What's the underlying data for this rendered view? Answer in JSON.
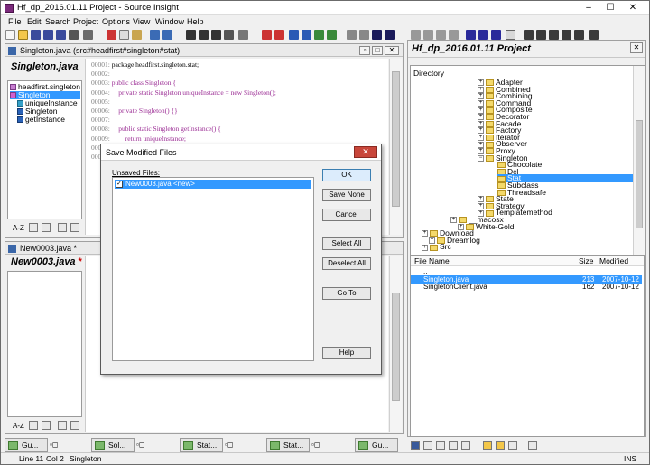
{
  "window": {
    "title": "Hf_dp_2016.01.11 Project - Source Insight",
    "min": "–",
    "max": "☐",
    "close": "✕"
  },
  "menu": [
    "File",
    "Edit",
    "Search",
    "Project",
    "Options",
    "View",
    "Window",
    "Help"
  ],
  "left_top_panel": {
    "window_title": "Singleton.java (src#headfirst#singleton#stat)",
    "symbol_heading": "Singleton.java",
    "symbols": [
      "headfirst.singleton",
      "Singleton",
      "uniqueInstance",
      "Singleton",
      "getInstance"
    ],
    "code": [
      {
        "n": "00001:",
        "text": "package headfirst.singleton.stat;"
      },
      {
        "n": "00002:",
        "text": ""
      },
      {
        "n": "00003:",
        "text": "public class Singleton {"
      },
      {
        "n": "00004:",
        "text": "    private static Singleton uniqueInstance = new Singleton();"
      },
      {
        "n": "00005:",
        "text": ""
      },
      {
        "n": "00006:",
        "text": "    private Singleton() {}"
      },
      {
        "n": "00007:",
        "text": ""
      },
      {
        "n": "00008:",
        "text": "    public static Singleton getInstance() {"
      },
      {
        "n": "00009:",
        "text": "        return uniqueInstance;"
      },
      {
        "n": "00010:",
        "text": "    }"
      },
      {
        "n": "00011:",
        "text": "}"
      }
    ],
    "sort_label": "A-Z"
  },
  "left_bottom_panel": {
    "window_title": "New0003.java *",
    "symbol_heading": "New0003.java",
    "modified_star": "*",
    "sort_label": "A-Z"
  },
  "dialog": {
    "title": "Save Modified Files",
    "list_label": "Unsaved Files:",
    "items": [
      {
        "label": "New0003.java <new>",
        "checked": true
      }
    ],
    "buttons": [
      "OK",
      "Save None",
      "Cancel",
      "Select All",
      "Deselect All",
      "Go To",
      "Help"
    ]
  },
  "project_panel": {
    "title": "Hf_dp_2016.01.11 Project",
    "directory_label": "Directory",
    "tree": [
      {
        "label": "Adapter",
        "expand": "+"
      },
      {
        "label": "Combined",
        "expand": "+"
      },
      {
        "label": "Combining",
        "expand": "+"
      },
      {
        "label": "Command",
        "expand": "+"
      },
      {
        "label": "Composite",
        "expand": "+"
      },
      {
        "label": "Decorator",
        "expand": "+"
      },
      {
        "label": "Facade",
        "expand": "+"
      },
      {
        "label": "Factory",
        "expand": "+"
      },
      {
        "label": "Iterator",
        "expand": "+"
      },
      {
        "label": "Observer",
        "expand": "+"
      },
      {
        "label": "Proxy",
        "expand": "+"
      },
      {
        "label": "Singleton",
        "expand": "−"
      },
      {
        "label": "Chocolate",
        "expand": ""
      },
      {
        "label": "Dcl",
        "expand": ""
      },
      {
        "label": "Stat",
        "expand": ""
      },
      {
        "label": "Subclass",
        "expand": ""
      },
      {
        "label": "Threadsafe",
        "expand": ""
      },
      {
        "label": "State",
        "expand": "+"
      },
      {
        "label": "Strategy",
        "expand": "+"
      },
      {
        "label": "Templatemethod",
        "expand": "+"
      },
      {
        "label": "__macosx",
        "expand": "+"
      },
      {
        "label": "White-Gold",
        "expand": "+"
      },
      {
        "label": "Download",
        "expand": "+"
      },
      {
        "label": "Dreamlog",
        "expand": "+"
      },
      {
        "label": "Src",
        "expand": "+"
      }
    ],
    "file_headers": {
      "name": "File Name",
      "size": "Size",
      "modified": "Modified"
    },
    "files": [
      {
        "name": "..",
        "size": "",
        "modified": ""
      },
      {
        "name": "Singleton.java",
        "size": "213",
        "modified": "2007-10-12"
      },
      {
        "name": "SingletonClient.java",
        "size": "162",
        "modified": "2007-10-12"
      }
    ]
  },
  "taskbar": [
    "Gu...",
    "Sol...",
    "Stat...",
    "Stat...",
    "Gu..."
  ],
  "status": {
    "line": "Line 11",
    "col": "Col 2",
    "symbol": "Singleton",
    "mode": "INS"
  }
}
